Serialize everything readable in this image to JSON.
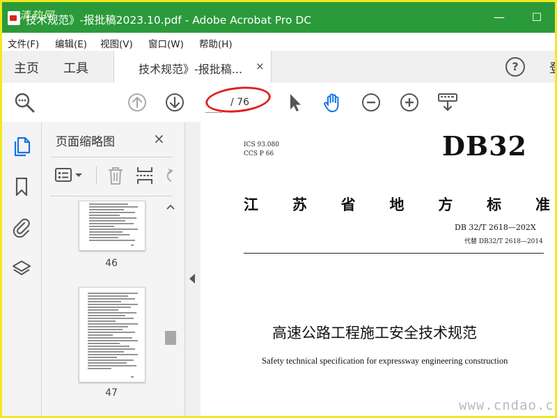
{
  "window": {
    "watermark_logo": "清软网",
    "title": "技术规范》-报批稿2023.10.pdf - Adobe Acrobat Pro DC",
    "minimize": "—",
    "maximize": "☐"
  },
  "menu": [
    "文件(F)",
    "编辑(E)",
    "视图(V)",
    "窗口(W)",
    "帮助(H)"
  ],
  "tabs": {
    "home": "主页",
    "tools": "工具",
    "document": "技术规范》-报批稿...",
    "close": "×",
    "help": "?",
    "signin": "登"
  },
  "toolbar": {
    "page_value": "",
    "page_total": "/ 76"
  },
  "thumbnails": {
    "title": "页面缩略图",
    "close": "×",
    "pages": [
      "46",
      "47"
    ]
  },
  "document": {
    "ics": "ICS 93.080",
    "ccs": "CCS P 66",
    "db": "DB32",
    "province": [
      "江",
      "苏",
      "省",
      "地",
      "方",
      "标",
      "准"
    ],
    "code": "DB 32/T 2618—202X",
    "replaces": "代替 DB32/T 2618—2014",
    "title_cn": "高速公路工程施工安全技术规范",
    "title_en": "Safety technical specification for expressway engineering construction"
  },
  "watermark": "www.cndao.com",
  "colors": {
    "title_bar": "#2b9a3b",
    "accent_blue": "#1473e6",
    "highlight_red": "#e02020",
    "frame_yellow": "#f2e81c"
  },
  "icons": {
    "toolbar": [
      "zoom-search-icon",
      "prev-page-icon",
      "next-page-icon",
      "select-arrow-icon",
      "hand-tool-icon",
      "zoom-out-icon",
      "zoom-in-icon",
      "keyboard-icon"
    ],
    "rail": [
      "page-thumbnails-icon",
      "bookmark-icon",
      "attachment-icon",
      "layers-icon"
    ],
    "panel": [
      "options-menu-icon",
      "delete-icon",
      "extract-icon",
      "rotate-icon"
    ]
  }
}
